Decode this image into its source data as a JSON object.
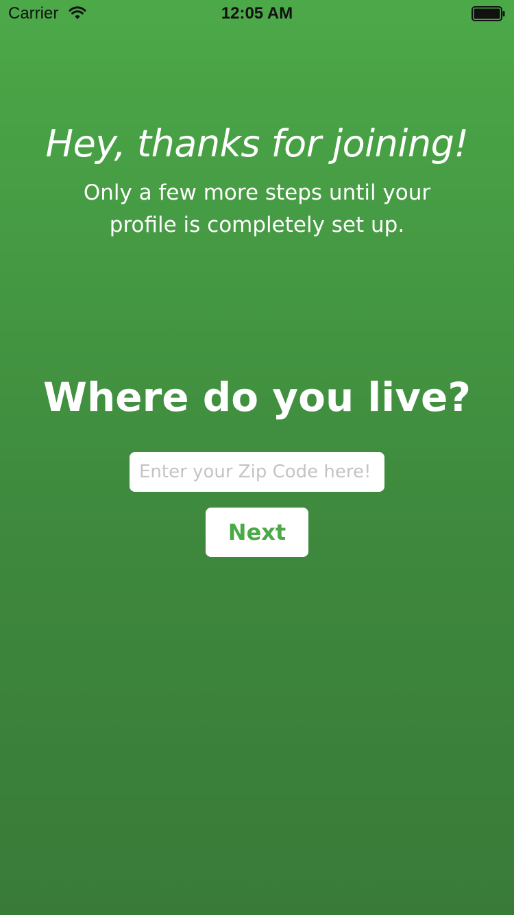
{
  "status_bar": {
    "carrier": "Carrier",
    "time": "12:05 AM",
    "wifi_icon": "wifi-icon",
    "battery_icon": "battery-full-icon"
  },
  "welcome": {
    "title": "Hey, thanks for joining!",
    "subtitle": "Only a few more steps until your profile is completely set up."
  },
  "form": {
    "question": "Where do you live?",
    "zip_value": "",
    "zip_placeholder": "Enter your Zip Code here!",
    "next_label": "Next"
  },
  "colors": {
    "background_top": "#4ca948",
    "background_bottom": "#397a38",
    "accent": "#4ca948",
    "text": "#ffffff",
    "placeholder": "#c4c4c6"
  }
}
